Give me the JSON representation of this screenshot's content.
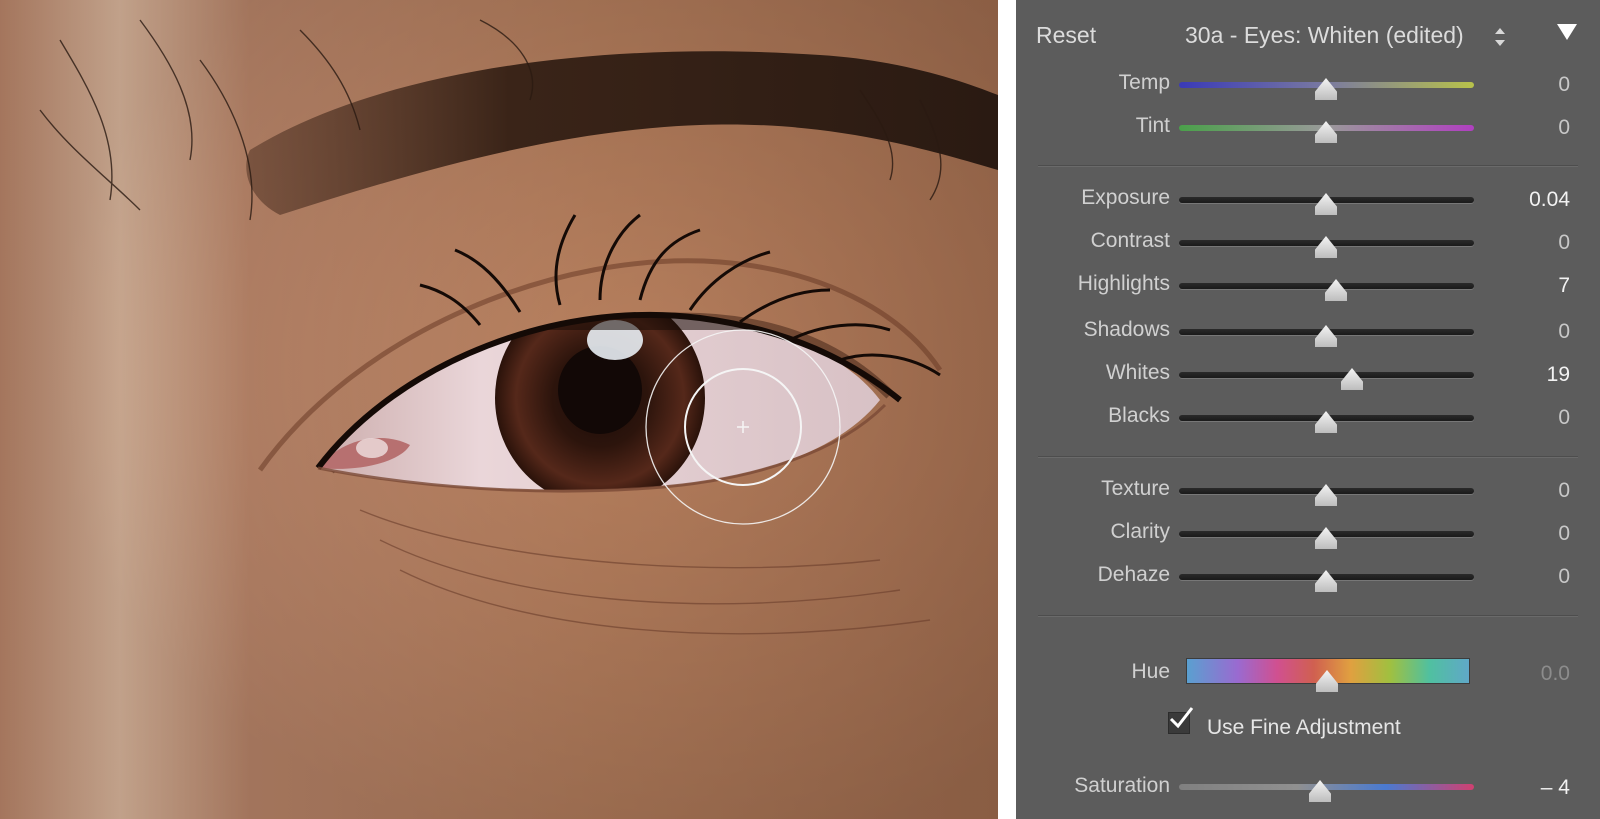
{
  "header": {
    "reset_label": "Reset",
    "preset_name": "30a - Eyes: Whiten (edited)",
    "preset_stepper_icon": "up-down-stepper-icon",
    "collapse_icon": "triangle-down-icon"
  },
  "sliders": {
    "temp": {
      "label": "Temp",
      "value": "0",
      "position": 0.5
    },
    "tint": {
      "label": "Tint",
      "value": "0",
      "position": 0.5
    },
    "exposure": {
      "label": "Exposure",
      "value": "0.04",
      "position": 0.5
    },
    "contrast": {
      "label": "Contrast",
      "value": "0",
      "position": 0.5
    },
    "highlights": {
      "label": "Highlights",
      "value": "7",
      "position": 0.535
    },
    "shadows": {
      "label": "Shadows",
      "value": "0",
      "position": 0.5
    },
    "whites": {
      "label": "Whites",
      "value": "19",
      "position": 0.595
    },
    "blacks": {
      "label": "Blacks",
      "value": "0",
      "position": 0.5
    },
    "texture": {
      "label": "Texture",
      "value": "0",
      "position": 0.5
    },
    "clarity": {
      "label": "Clarity",
      "value": "0",
      "position": 0.5
    },
    "dehaze": {
      "label": "Dehaze",
      "value": "0",
      "position": 0.5
    },
    "hue": {
      "label": "Hue",
      "value": "0.0",
      "position": 0.5
    },
    "saturation": {
      "label": "Saturation",
      "value": "– 4",
      "position": 0.48
    }
  },
  "fine_adjustment": {
    "label": "Use Fine Adjustment",
    "checked": true
  },
  "brush": {
    "cursor_icon": "brush-cursor-icon"
  },
  "colors": {
    "panel_bg": "#5c5c5c",
    "skin": "#c89474",
    "iris": "#4a2418"
  }
}
